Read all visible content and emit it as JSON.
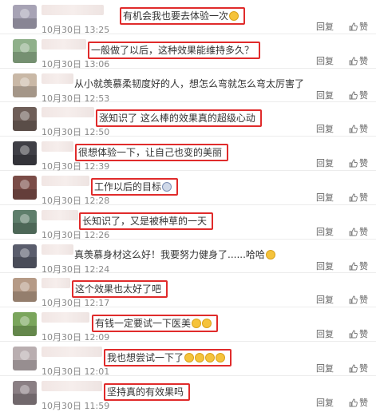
{
  "comments": [
    {
      "text": "有机会我也要去体验一次",
      "time": "10月30日 13:25",
      "reply": "回复",
      "like": "赞",
      "emojis": [
        "smile"
      ],
      "avatar_color": "#a7a3b5",
      "highlighted": true
    },
    {
      "text": "一般做了以后，这种效果能维持多久？",
      "time": "10月30日 13:06",
      "reply": "回复",
      "like": "赞",
      "emojis": [],
      "avatar_color": "#8fb08a",
      "highlighted": true
    },
    {
      "text": "从小就羡慕柔韧度好的人，想怎么弯就怎么弯太厉害了",
      "time": "10月30日 12:53",
      "reply": "回复",
      "like": "赞",
      "emojis": [],
      "avatar_color": "#c9b8a6",
      "highlighted": false
    },
    {
      "text": "涨知识了 这么棒的效果真的超级心动",
      "time": "10月30日 12:50",
      "reply": "回复",
      "like": "赞",
      "emojis": [],
      "avatar_color": "#6e5e58",
      "highlighted": true
    },
    {
      "text": "很想体验一下，让自己也变的美丽",
      "time": "10月30日 12:39",
      "reply": "回复",
      "like": "赞",
      "emojis": [],
      "avatar_color": "#3f3f46",
      "highlighted": true
    },
    {
      "text": "工作以后的目标",
      "time": "10月30日 12:28",
      "reply": "回复",
      "like": "赞",
      "emojis": [
        "blue"
      ],
      "avatar_color": "#7a4c47",
      "highlighted": true
    },
    {
      "text": "长知识了，又是被种草的一天",
      "time": "10月30日 12:26",
      "reply": "回复",
      "like": "赞",
      "emojis": [],
      "avatar_color": "#5e7e6b",
      "highlighted": true
    },
    {
      "text": "真羡慕身材这么好！我要努力健身了......哈哈",
      "time": "10月30日 12:24",
      "reply": "回复",
      "like": "赞",
      "emojis": [
        "smile"
      ],
      "avatar_color": "#5a5d6c",
      "highlighted": false
    },
    {
      "text": "这个效果也太好了吧",
      "time": "10月30日 12:17",
      "reply": "回复",
      "like": "赞",
      "emojis": [],
      "avatar_color": "#b59a86",
      "highlighted": true
    },
    {
      "text": "有钱一定要试一下医美",
      "time": "10月30日 12:09",
      "reply": "回复",
      "like": "赞",
      "emojis": [
        "smile",
        "smile"
      ],
      "avatar_color": "#7aa55c",
      "highlighted": true
    },
    {
      "text": "我也想尝试一下了",
      "time": "10月30日 12:01",
      "reply": "回复",
      "like": "赞",
      "emojis": [
        "smile",
        "smile",
        "smile",
        "smile"
      ],
      "avatar_color": "#b9aeb0",
      "highlighted": true
    },
    {
      "text": "坚持真的有效果吗",
      "time": "10月30日 11:59",
      "reply": "回复",
      "like": "赞",
      "emojis": [],
      "avatar_color": "#8a7f84",
      "highlighted": true
    }
  ]
}
